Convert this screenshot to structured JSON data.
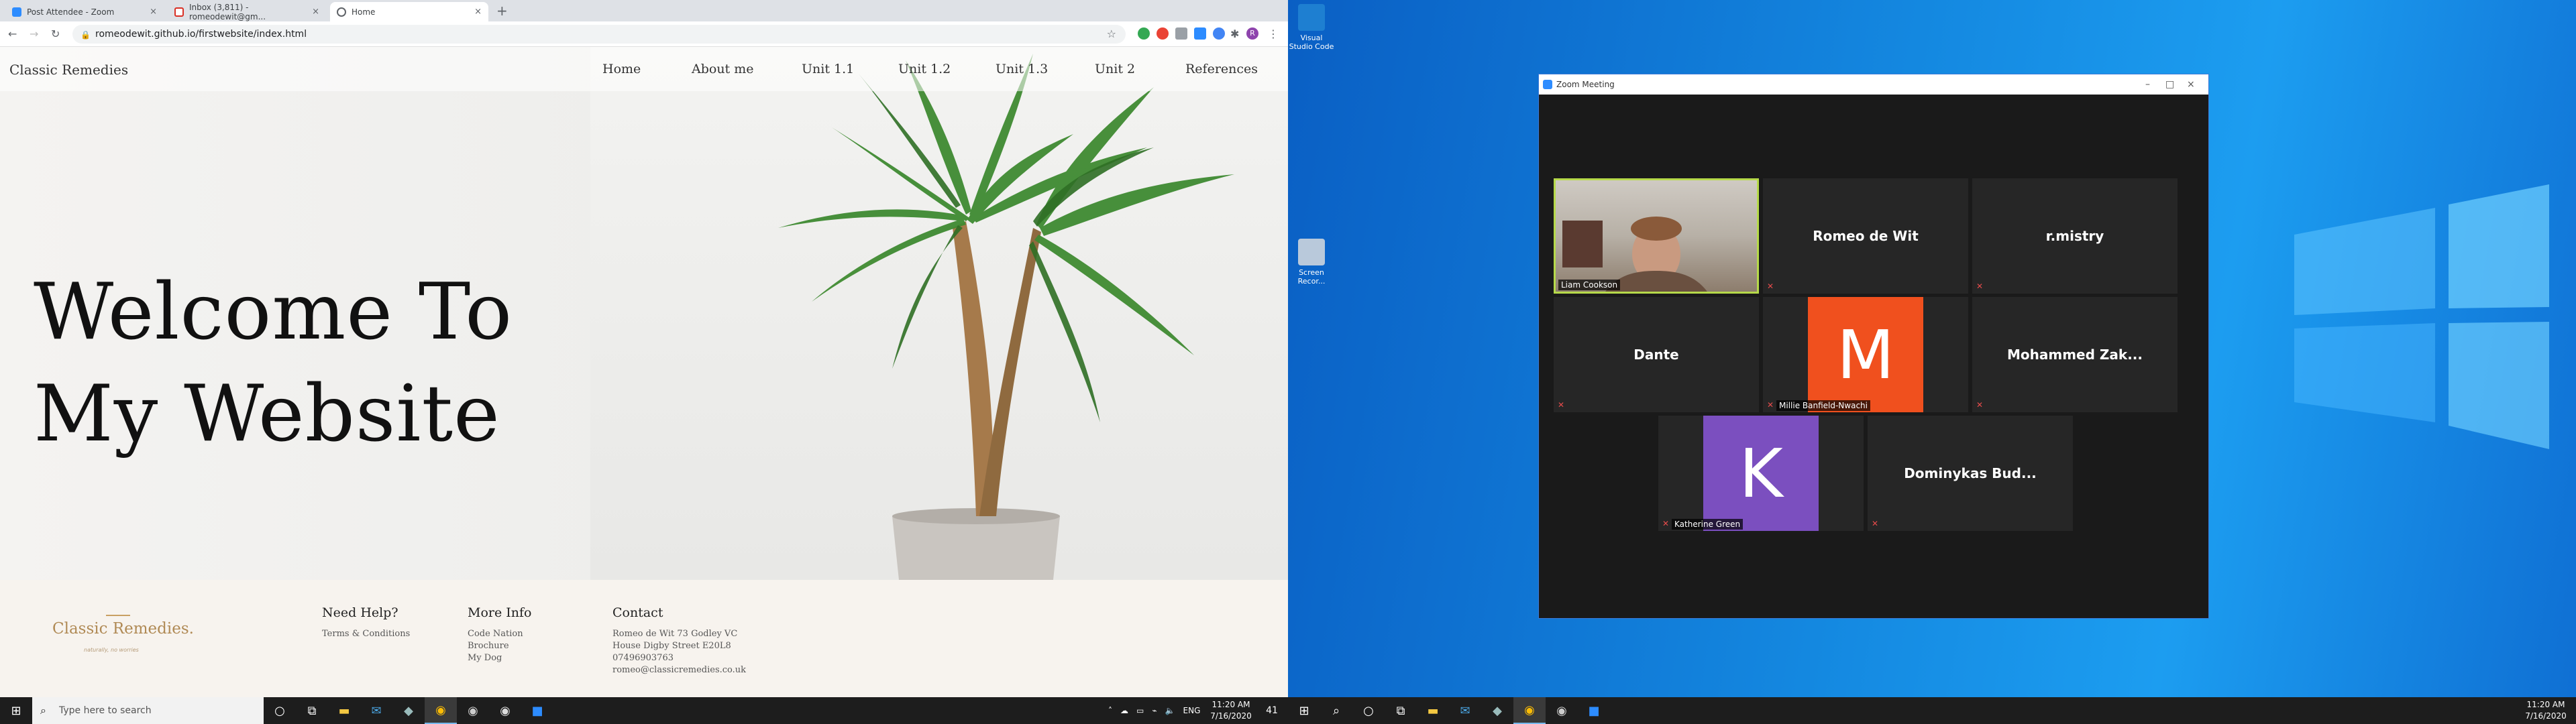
{
  "browser": {
    "tabs": [
      {
        "title": "Post Attendee - Zoom",
        "color": "#2d8cff"
      },
      {
        "title": "Inbox (3,811) - romeodewit@gm...",
        "color": "#d93025"
      },
      {
        "title": "Home",
        "color": "#5f6368"
      }
    ],
    "new_tab": "+",
    "url": "romeodewit.github.io/firstwebsite/index.html",
    "profile_initial": "R"
  },
  "site": {
    "brand": "Classic Remedies",
    "nav": [
      "Home",
      "About me",
      "Unit 1.1",
      "Unit 1.2",
      "Unit 1.3",
      "Unit 2",
      "References"
    ],
    "hero_line1": "Welcome To",
    "hero_line2": "My Website",
    "footer": {
      "logo": "Classic Remedies.",
      "logo_sub": "naturally, no worries",
      "help_title": "Need Help?",
      "help_links": [
        "Terms & Conditions"
      ],
      "more_title": "More Info",
      "more_links": [
        "Code Nation",
        "Brochure",
        "My Dog"
      ],
      "contact_title": "Contact",
      "contact_lines": [
        "Romeo de Wit 73 Godley VC",
        "House Digby Street E20L8",
        "07496903763",
        "romeo@classicremedies.co.uk"
      ]
    }
  },
  "taskbar_left": {
    "search_placeholder": "Type here to search",
    "tray_lang": "ENG",
    "time": "11:20 AM",
    "date": "7/16/2020",
    "notif_count": "41"
  },
  "taskbar_right": {
    "time": "11:20 AM",
    "date": "7/16/2020"
  },
  "desktop": {
    "icons": [
      {
        "label": "Visual Studio Code"
      },
      {
        "label": "Screen Recor..."
      }
    ]
  },
  "zoom": {
    "title": "Zoom Meeting",
    "participants": [
      {
        "name": "Liam Cookson",
        "type": "video",
        "show_label": true
      },
      {
        "name": "Romeo de Wit",
        "type": "name"
      },
      {
        "name": "r.mistry",
        "type": "name"
      },
      {
        "name": "Dante",
        "type": "name"
      },
      {
        "name": "Millie Banfield-Nwachi",
        "type": "avatar",
        "initial": "M",
        "color": "#f0501e"
      },
      {
        "name": "Mohammed  Zak...",
        "type": "name"
      },
      {
        "name": "Katherine Green",
        "type": "avatar",
        "initial": "K",
        "color": "#7b4fbf"
      },
      {
        "name": "Dominykas  Bud...",
        "type": "name"
      }
    ]
  }
}
